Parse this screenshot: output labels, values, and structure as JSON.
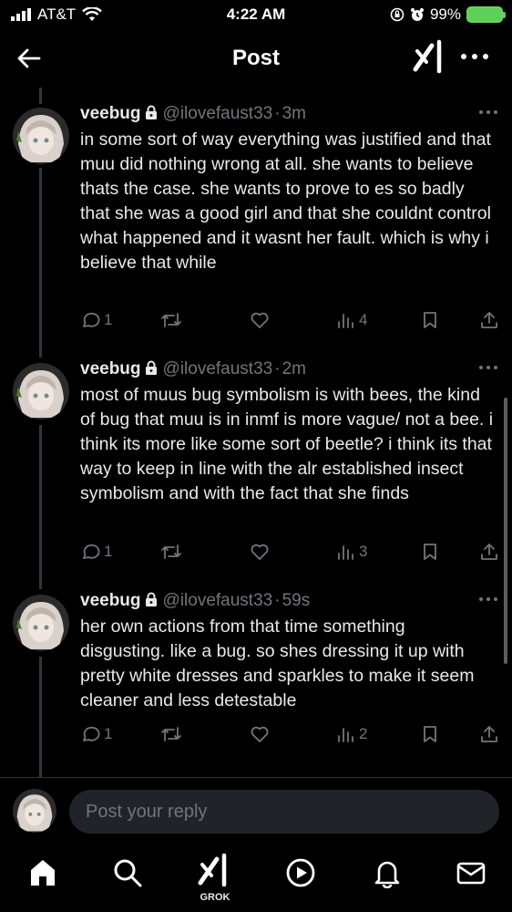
{
  "status_bar": {
    "carrier": "AT&T",
    "time": "4:22 AM",
    "battery": "99%"
  },
  "header": {
    "title": "Post"
  },
  "author": {
    "name": "veebug",
    "handle": "@ilovefaust33"
  },
  "posts": [
    {
      "time": "3m",
      "text": "in some sort of way everything was justified and that muu did nothing wrong at all. she wants to believe thats the case. she wants to prove to es so badly that she was a good girl and that she couldnt control what happened and it wasnt her fault. which is why i believe that while",
      "replies": "1",
      "views": "4"
    },
    {
      "time": "2m",
      "text": "most of muus bug symbolism is with bees, the kind of bug that muu is in inmf is more vague/ not a bee. i think its more like some sort of beetle? i think its that way to keep in line with the alr established insect symbolism and with the fact that she finds",
      "replies": "1",
      "views": "3"
    },
    {
      "time": "59s",
      "text": "her own actions from that time something disgusting. like a bug. so shes dressing it up with pretty white dresses and sparkles to make it seem cleaner and less detestable",
      "replies": "1",
      "views": "2"
    }
  ],
  "reply": {
    "placeholder": "Post your reply"
  },
  "tab_bar": {
    "grok_label": "GROK"
  },
  "icons": [
    "back-arrow-icon",
    "grok-icon",
    "more-icon",
    "lock-icon",
    "reply-icon",
    "retweet-icon",
    "heart-icon",
    "views-icon",
    "bookmark-icon",
    "share-icon",
    "home-icon",
    "search-icon",
    "play-icon",
    "bell-icon",
    "mail-icon"
  ],
  "colors": {
    "background": "#000000",
    "text": "#e7e9ea",
    "muted": "#71767b",
    "battery": "#5dd05a"
  }
}
